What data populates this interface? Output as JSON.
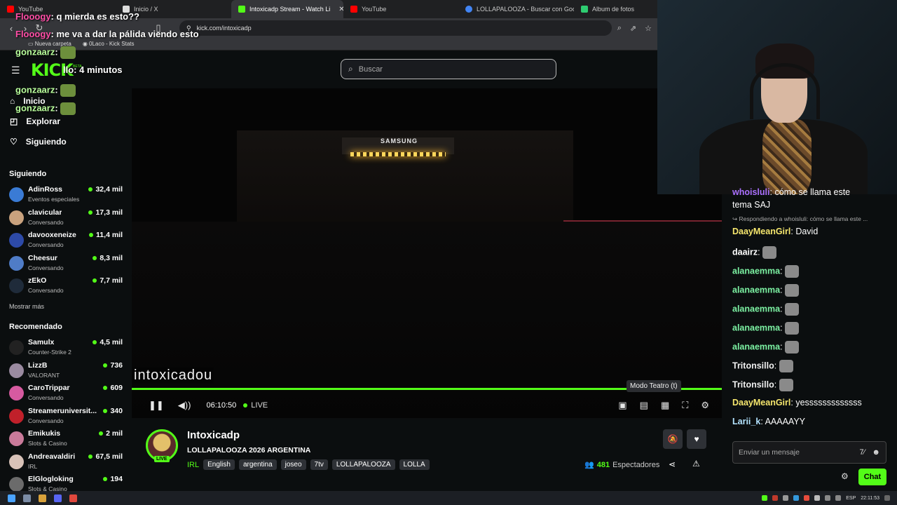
{
  "browser": {
    "tabs": [
      {
        "label": "YouTube",
        "color": "#ff0000",
        "active": false
      },
      {
        "label": "Inicio / X",
        "color": "#ffffff",
        "active": false
      },
      {
        "label": "Intoxicadp Stream - Watch Li",
        "color": "#53fc18",
        "active": true
      },
      {
        "label": "YouTube",
        "color": "#ff0000",
        "active": false
      },
      {
        "label": "LOLLAPALOOZA - Buscar con Google",
        "color": "#4285f4",
        "active": false
      },
      {
        "label": "Album de fotos",
        "color": "#2ecc71",
        "active": false
      }
    ],
    "url": "kick.com/intoxicadp",
    "bookmarks": [
      "Nueva carpeta",
      "0Laco - Kick Stats"
    ]
  },
  "overlay_chat": [
    {
      "user": "Flooogy",
      "text": "q mierda es esto??"
    },
    {
      "user": "Flooogy",
      "text": "me va a dar la pálida viendo esto"
    },
    {
      "user": "gonzaarz",
      "text": ""
    },
    {
      "user": "",
      "text": "llo: 4 minutos"
    },
    {
      "user": "gonzaarz",
      "text": ""
    },
    {
      "user": "gonzaarz",
      "text": ""
    }
  ],
  "header": {
    "logo": "KICK",
    "beta": "BETA",
    "search_placeholder": "Buscar"
  },
  "sidebar": {
    "nav": [
      {
        "label": "Inicio",
        "icon": "home-icon"
      },
      {
        "label": "Explorar",
        "icon": "compass-icon"
      },
      {
        "label": "Siguiendo",
        "icon": "heart-icon"
      }
    ],
    "following_title": "Siguiendo",
    "following": [
      {
        "name": "AdinRoss",
        "category": "Eventos especiales",
        "viewers": "32,4 mil",
        "color": "#3a7bd5"
      },
      {
        "name": "clavicular",
        "category": "Conversando",
        "viewers": "17,3 mil",
        "color": "#c9a27e"
      },
      {
        "name": "davooxeneize",
        "category": "Conversando",
        "viewers": "11,4 mil",
        "color": "#2d4aa8"
      },
      {
        "name": "Cheesur",
        "category": "Conversando",
        "viewers": "8,3 mil",
        "color": "#4f7cc7"
      },
      {
        "name": "zEkO",
        "category": "Conversando",
        "viewers": "7,7 mil",
        "color": "#1f2b3a"
      }
    ],
    "more_label": "Mostrar más",
    "recommended_title": "Recomendado",
    "recommended": [
      {
        "name": "Samulx",
        "category": "Counter-Strike 2",
        "viewers": "4,5 mil",
        "color": "#222222"
      },
      {
        "name": "LizzB",
        "category": "VALORANT",
        "viewers": "736",
        "color": "#9a8aa0"
      },
      {
        "name": "CaroTrippar",
        "category": "Conversando",
        "viewers": "609",
        "color": "#d65aa0"
      },
      {
        "name": "Streameruniversit...",
        "category": "Conversando",
        "viewers": "340",
        "color": "#c0202a"
      },
      {
        "name": "Emikukis",
        "category": "Slots & Casino",
        "viewers": "2 mil",
        "color": "#c97a9a"
      },
      {
        "name": "Andreavaldiri",
        "category": "IRL",
        "viewers": "67,5 mil",
        "color": "#d8c2b8"
      },
      {
        "name": "ElGlogloking",
        "category": "Slots & Casino",
        "viewers": "194",
        "color": "#6b6b6b"
      }
    ]
  },
  "video": {
    "stage_sign": "SAMSUNG",
    "watermark": "intoxicadou",
    "tooltip": "Modo Teatro (t)",
    "time": "06:10:50",
    "live_label": "LIVE",
    "progress": 1.0
  },
  "stream_info": {
    "channel": "Intoxicadp",
    "live_badge": "LIVE",
    "title": "LOLLAPALOOZA 2026 ARGENTINA",
    "category": "IRL",
    "tags": [
      "English",
      "argentina",
      "joseo",
      "7tv",
      "LOLLAPALOOZA",
      "LOLLA"
    ],
    "viewers": "481",
    "viewers_label": "Espectadores"
  },
  "chat": {
    "messages": [
      {
        "user": "whoisluli",
        "text": "cómo se llama este",
        "color": "#a970ff"
      },
      {
        "user": "",
        "text": "tema SAJ",
        "color": "#ffffff"
      },
      {
        "reply": "Respondiendo a whoisluli: cómo se llama este ..."
      },
      {
        "user": "DaayMeanGirl",
        "text": "David",
        "color": "#f5e66d"
      },
      {
        "user": "daairz",
        "text": "",
        "color": "#ffffff"
      },
      {
        "user": "alanaemma",
        "text": "",
        "color": "#7cf2a3"
      },
      {
        "user": "alanaemma",
        "text": "",
        "color": "#7cf2a3"
      },
      {
        "user": "alanaemma",
        "text": "",
        "color": "#7cf2a3"
      },
      {
        "user": "alanaemma",
        "text": "",
        "color": "#7cf2a3"
      },
      {
        "user": "alanaemma",
        "text": "",
        "color": "#7cf2a3"
      },
      {
        "user": "Tritonsillo",
        "text": "",
        "color": "#f0f0f0"
      },
      {
        "user": "Tritonsillo",
        "text": "",
        "color": "#f0f0f0"
      },
      {
        "user": "DaayMeanGirl",
        "text": "yesssssssssssss",
        "color": "#f5e66d"
      },
      {
        "user": "Larii_k",
        "text": "AAAAAYY",
        "color": "#b3e3ff"
      }
    ],
    "input_placeholder": "Enviar un mensaje",
    "send_label": "Chat"
  },
  "taskbar": {
    "lang": "ESP",
    "clock": "22:11:53"
  }
}
